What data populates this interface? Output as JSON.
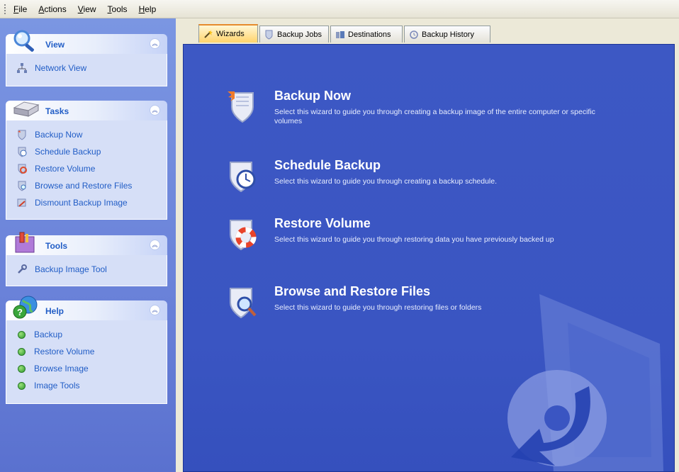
{
  "menu": [
    {
      "pre": "",
      "u": "F",
      "post": "ile"
    },
    {
      "pre": "",
      "u": "A",
      "post": "ctions"
    },
    {
      "pre": "",
      "u": "V",
      "post": "iew"
    },
    {
      "pre": "",
      "u": "T",
      "post": "ools"
    },
    {
      "pre": "",
      "u": "H",
      "post": "elp"
    }
  ],
  "panels": {
    "view": {
      "title": "View",
      "items": [
        "Network View"
      ]
    },
    "tasks": {
      "title": "Tasks",
      "items": [
        "Backup Now",
        "Schedule Backup",
        "Restore Volume",
        "Browse and Restore Files",
        "Dismount Backup Image"
      ]
    },
    "tools": {
      "title": "Tools",
      "items": [
        "Backup Image Tool"
      ]
    },
    "help": {
      "title": "Help",
      "items": [
        "Backup",
        "Restore Volume",
        "Browse Image",
        "Image Tools"
      ]
    }
  },
  "tabs": [
    "Wizards",
    "Backup Jobs",
    "Destinations",
    "Backup History"
  ],
  "wizards": [
    {
      "title": "Backup Now",
      "desc": "Select this wizard to guide you through creating a backup image of the entire computer or specific volumes"
    },
    {
      "title": "Schedule Backup",
      "desc": "Select this wizard to guide you through creating a backup schedule."
    },
    {
      "title": "Restore Volume",
      "desc": "Select this wizard to guide you through restoring data you have previously backed up"
    },
    {
      "title": "Browse and Restore Files",
      "desc": "Select this wizard to guide you through restoring files or folders"
    }
  ],
  "icons": {
    "view": "magnifier-icon",
    "tasks": "drive-icon",
    "tools": "toolbox-icon",
    "help": "globe-help-icon"
  },
  "colors": {
    "content_bg": "#3a55c2",
    "link": "#215dc6",
    "active_tab": "#ffd36b"
  }
}
